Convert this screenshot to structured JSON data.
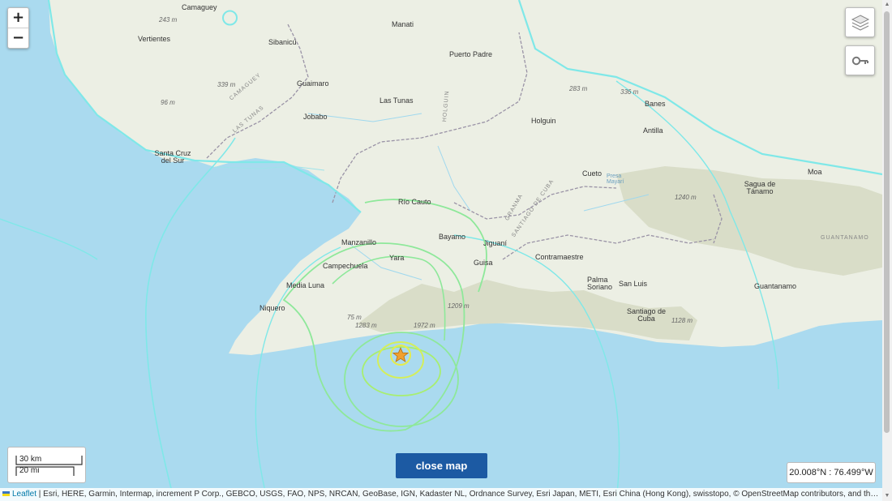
{
  "map": {
    "cities": [
      {
        "name": "Camaguey",
        "cls": "city"
      },
      {
        "name": "Manati",
        "cls": "city"
      },
      {
        "name": "Vertientes",
        "cls": "city"
      },
      {
        "name": "Sibanicú",
        "cls": "city"
      },
      {
        "name": "Puerto Padre",
        "cls": "city"
      },
      {
        "name": "Guaimaro",
        "cls": "city"
      },
      {
        "name": "Las Tunas",
        "cls": "city"
      },
      {
        "name": "Jobabo",
        "cls": "city"
      },
      {
        "name": "Holguin",
        "cls": "city"
      },
      {
        "name": "Banes",
        "cls": "city"
      },
      {
        "name": "Antilla",
        "cls": "city"
      },
      {
        "name": "Santa Cruz del Sur",
        "cls": "city"
      },
      {
        "name": "Cueto",
        "cls": "city"
      },
      {
        "name": "Moa",
        "cls": "city"
      },
      {
        "name": "Sagua de Tánamo",
        "cls": "city"
      },
      {
        "name": "Río Cauto",
        "cls": "city"
      },
      {
        "name": "Bayamo",
        "cls": "city"
      },
      {
        "name": "Manzanillo",
        "cls": "city"
      },
      {
        "name": "Jiguaní",
        "cls": "city"
      },
      {
        "name": "Campechuela",
        "cls": "city"
      },
      {
        "name": "Yara",
        "cls": "city"
      },
      {
        "name": "Guisa",
        "cls": "city"
      },
      {
        "name": "Contramaestre",
        "cls": "city"
      },
      {
        "name": "Media Luna",
        "cls": "city"
      },
      {
        "name": "Palma Soriano",
        "cls": "city"
      },
      {
        "name": "San Luis",
        "cls": "city"
      },
      {
        "name": "Guantanamo",
        "cls": "city"
      },
      {
        "name": "Niquero",
        "cls": "city"
      },
      {
        "name": "Santiago de Cuba",
        "cls": "city"
      },
      {
        "name": "Presa Mayarí",
        "cls": "city"
      }
    ],
    "elevations": [
      "243 m",
      "339 m",
      "96 m",
      "283 m",
      "336 m",
      "1240 m",
      "75 m",
      "1283 m",
      "1972 m",
      "1128 m",
      "1209 m"
    ],
    "provinces": [
      "CAMAGUEY",
      "LAS TUNAS",
      "HOLGUIN",
      "GRANMA",
      "SANTIAGO DE CUBA",
      "GUANTANAMO"
    ],
    "epicenter_icon": "star-icon"
  },
  "controls": {
    "zoom_in": "+",
    "zoom_out": "−",
    "layers_icon": "layers-icon",
    "legend_icon": "key-icon",
    "close_map_label": "close map"
  },
  "scale": {
    "km": "30 km",
    "mi": "20 mi"
  },
  "coordinates": "20.008°N : 76.499°W",
  "attribution": {
    "leaflet": "Leaflet",
    "text": " | Esri, HERE, Garmin, Intermap, increment P Corp., GEBCO, USGS, FAO, NPS, NRCAN, GeoBase, IGN, Kadaster NL, Ordnance Survey, Esri Japan, METI, Esri China (Hong Kong), swisstopo, © OpenStreetMap contributors, and the GIS U..."
  },
  "colors": {
    "water": "#aadaef",
    "land": "#ecefe4",
    "mountain": "#d9ddc8",
    "border": "#9a93a6",
    "mmi_cyan": "#7fe8e8",
    "mmi_green": "#8ee89a",
    "mmi_yellow": "#d4ee5a",
    "epicenter": "#f0a030",
    "button": "#1c5aa3"
  }
}
